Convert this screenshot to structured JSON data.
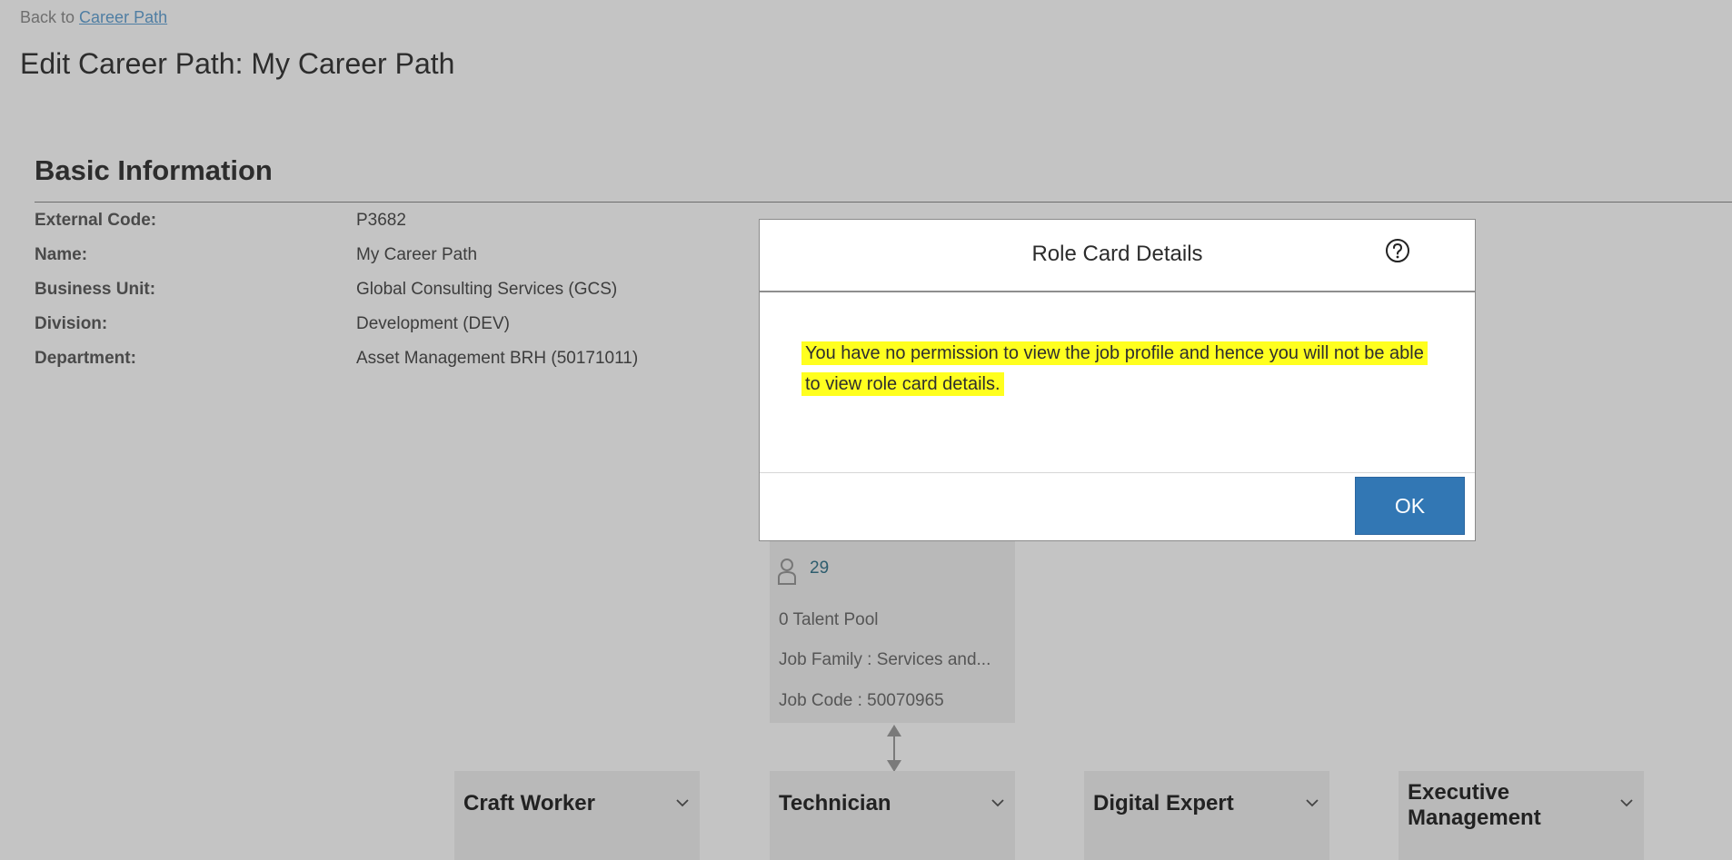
{
  "nav": {
    "back_prefix": "Back to",
    "back_link": "Career Path"
  },
  "page": {
    "title": "Edit Career Path: My Career Path"
  },
  "basic_info": {
    "title": "Basic Information",
    "fields": [
      {
        "label": "External Code:",
        "value": "P3682"
      },
      {
        "label": "Name:",
        "value": "My Career Path"
      },
      {
        "label": "Business Unit:",
        "value": "Global Consulting Services (GCS)"
      },
      {
        "label": "Division:",
        "value": "Development (DEV)"
      },
      {
        "label": "Department:",
        "value": "Asset Management BRH (50171011)"
      }
    ]
  },
  "role_card": {
    "incumbent_count": "29",
    "talent_pool": "0 Talent Pool",
    "job_family": "Job Family : Services and...",
    "job_code": "Job Code : 50070965"
  },
  "job_cards": [
    {
      "label": "Craft Worker"
    },
    {
      "label": "Technician"
    },
    {
      "label": "Digital Expert"
    },
    {
      "label": "Executive Management"
    }
  ],
  "modal": {
    "title": "Role Card Details",
    "message": "You have no permission to view the job profile and hence you will not be able to view role card details.",
    "ok_label": "OK"
  },
  "colors": {
    "backdrop": "#c4c4c4",
    "card": "#b9b9b9",
    "primary_button": "#3277b4",
    "highlight": "#ffff1f"
  },
  "icons": [
    "help-icon",
    "person-icon",
    "chevron-down-icon",
    "bidirectional-arrow-icon"
  ]
}
